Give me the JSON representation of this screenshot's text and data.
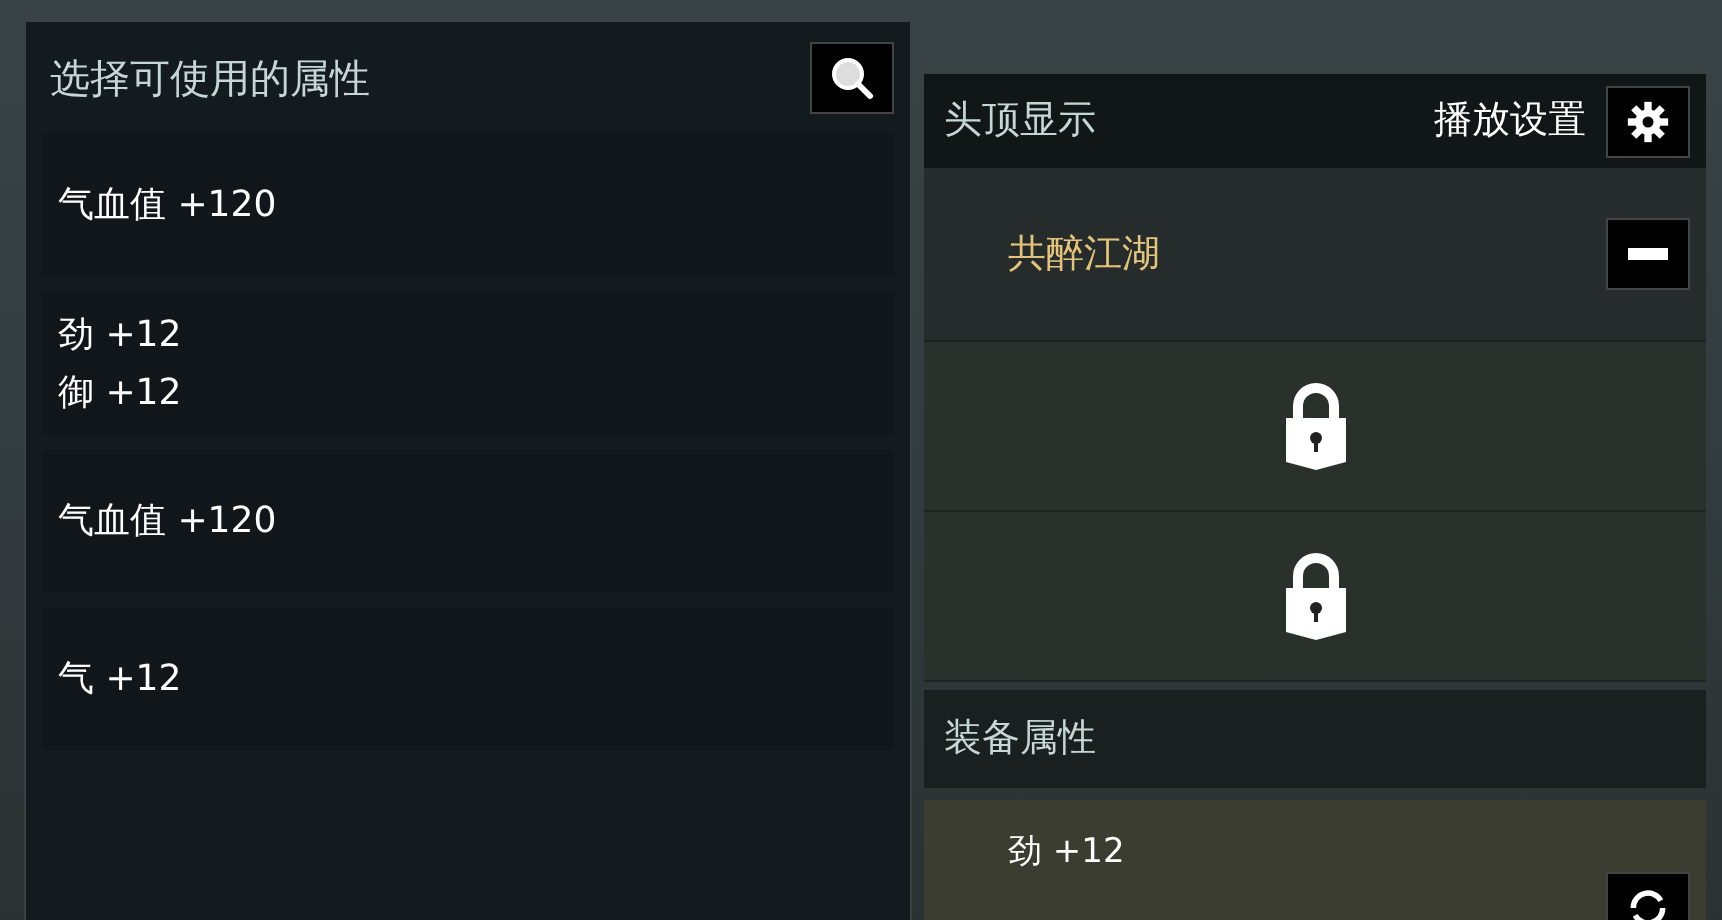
{
  "attribute_picker": {
    "title": "选择可使用的属性",
    "options": [
      {
        "lines": [
          "气血值 +120"
        ]
      },
      {
        "lines": [
          "劲 +12",
          "御 +12"
        ]
      },
      {
        "lines": [
          "气血值 +120"
        ]
      },
      {
        "lines": [
          "气 +12"
        ]
      }
    ]
  },
  "overhead_display": {
    "title": "头顶显示",
    "settings_label": "播放设置",
    "slots": [
      {
        "kind": "title",
        "text": "共醉江湖"
      },
      {
        "kind": "locked"
      },
      {
        "kind": "locked"
      }
    ]
  },
  "equipment_attributes": {
    "title": "装备属性",
    "lines": [
      "劲 +12"
    ]
  }
}
